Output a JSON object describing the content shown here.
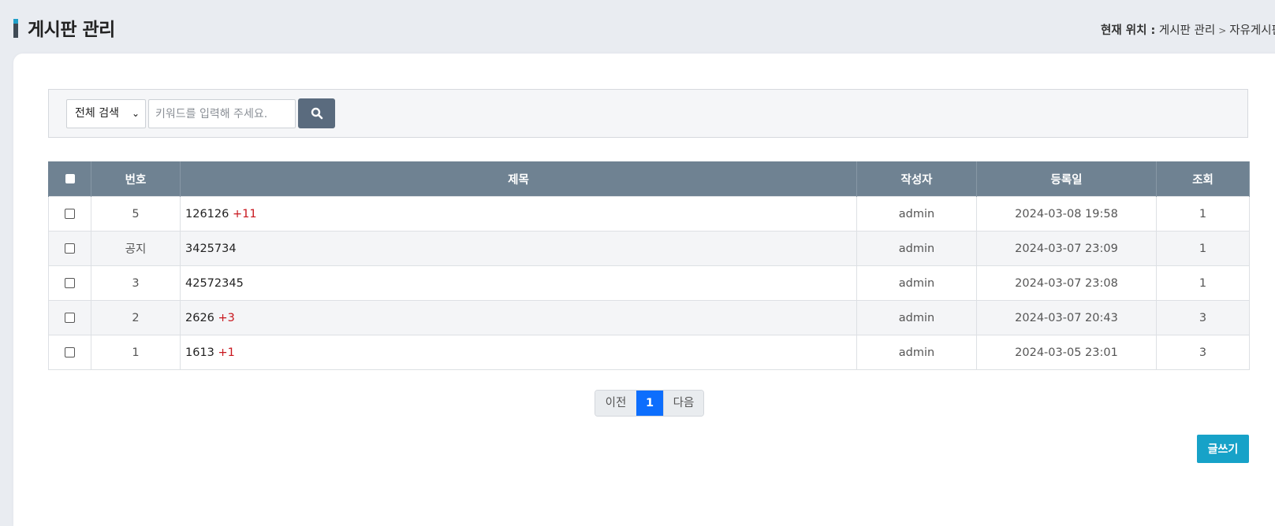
{
  "header": {
    "title": "게시판 관리",
    "breadcrumb_label": "현재 위치 :",
    "breadcrumb_items": [
      "게시판 관리",
      "자유게시판"
    ]
  },
  "search": {
    "scope_selected": "전체 검색",
    "placeholder": "키워드를 입력해 주세요.",
    "button_icon": "search-icon"
  },
  "table": {
    "columns": [
      "번호",
      "제목",
      "작성자",
      "등록일",
      "조회"
    ],
    "rows": [
      {
        "number": "5",
        "subject": "126126",
        "comments": "+11",
        "author": "admin",
        "date": "2024-03-08 19:58",
        "views": "1"
      },
      {
        "number": "공지",
        "subject": "3425734",
        "comments": "",
        "author": "admin",
        "date": "2024-03-07 23:09",
        "views": "1"
      },
      {
        "number": "3",
        "subject": "42572345",
        "comments": "",
        "author": "admin",
        "date": "2024-03-07 23:08",
        "views": "1"
      },
      {
        "number": "2",
        "subject": "2626",
        "comments": "+3",
        "author": "admin",
        "date": "2024-03-07 20:43",
        "views": "3"
      },
      {
        "number": "1",
        "subject": "1613",
        "comments": "+1",
        "author": "admin",
        "date": "2024-03-05 23:01",
        "views": "3"
      }
    ]
  },
  "pagination": {
    "prev_label": "이전",
    "current_page": "1",
    "next_label": "다음"
  },
  "actions": {
    "write_label": "글쓰기"
  },
  "colors": {
    "table_header": "#6f8292",
    "search_button": "#5a6b7e",
    "current_page": "#0d6efd",
    "write_button": "#17a2c8",
    "comment_count": "#c8161d"
  }
}
